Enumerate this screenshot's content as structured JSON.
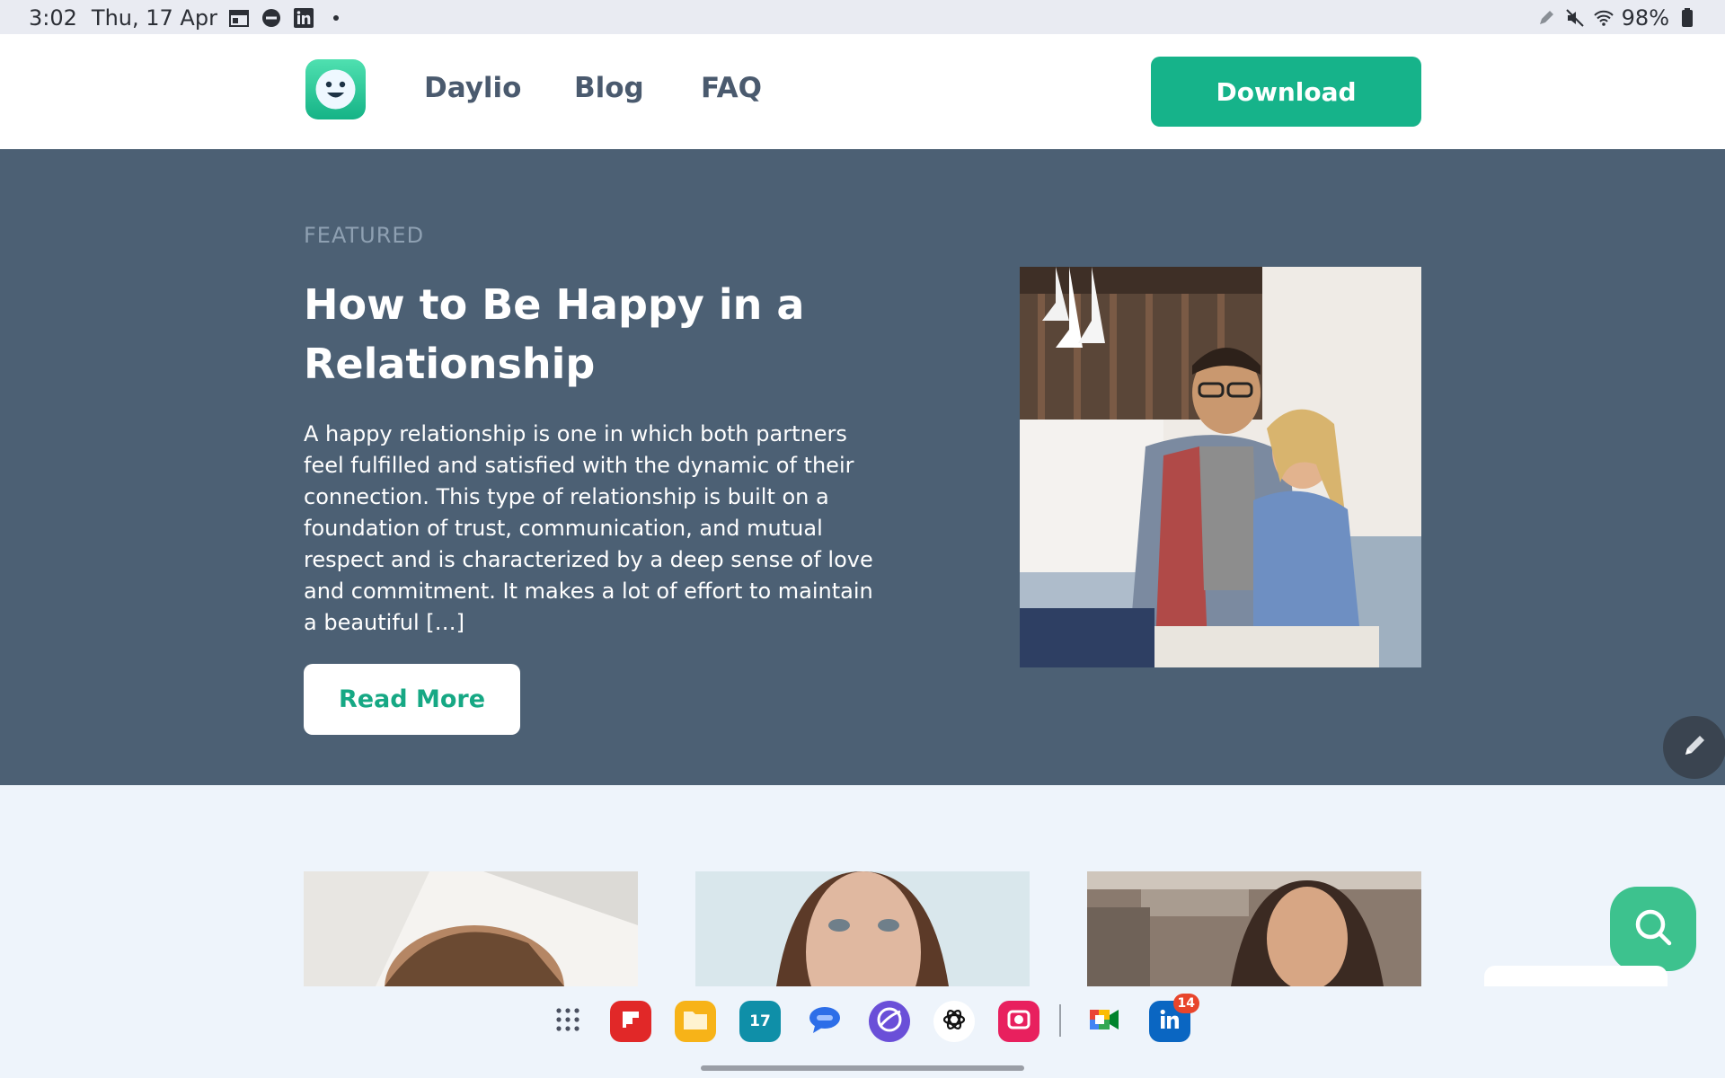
{
  "status_bar": {
    "time": "3:02",
    "date": "Thu, 17 Apr",
    "battery": "98%",
    "left_icons": [
      "calendar-icon",
      "dnd-icon",
      "linkedin-icon",
      "dot-icon"
    ],
    "right_icons": [
      "pen-icon",
      "mute-icon",
      "wifi-icon",
      "battery-icon"
    ]
  },
  "header": {
    "nav": [
      "Daylio",
      "Blog",
      "FAQ"
    ],
    "download_label": "Download",
    "brand_color": "#16b38a"
  },
  "featured": {
    "label": "FEATURED",
    "title": "How to Be Happy in a Relationship",
    "excerpt": "A happy relationship is one in which both partners feel fulfilled and satisfied with the dynamic of their connection. This type of relationship is built on a foundation of trust, communication, and mutual respect and is characterized by a deep sense of love and commitment. It makes a lot of effort to maintain a beautiful […]",
    "read_more_label": "Read More",
    "image_alt": "couple-on-sofa"
  },
  "dock": {
    "items": [
      {
        "name": "app-drawer",
        "icon": "grid-icon"
      },
      {
        "name": "flipboard",
        "icon": "flipboard-icon",
        "color": "#e12828"
      },
      {
        "name": "files",
        "icon": "folder-icon",
        "color": "#f7b318"
      },
      {
        "name": "calendar",
        "icon": "calendar-icon",
        "color": "#0f8fa8",
        "label": "17"
      },
      {
        "name": "messages",
        "icon": "chat-icon",
        "color": "#2d6ee8"
      },
      {
        "name": "internet",
        "icon": "browser-icon",
        "color": "#6a4fd8"
      },
      {
        "name": "chatgpt",
        "icon": "openai-icon",
        "color": "#ffffff"
      },
      {
        "name": "screen-recorder",
        "icon": "camera-icon",
        "color": "#e8205e"
      },
      {
        "name": "meet",
        "icon": "video-icon",
        "color": "#ffffff"
      },
      {
        "name": "linkedin",
        "icon": "linkedin-icon",
        "color": "#0a66c2",
        "badge": "14"
      }
    ]
  }
}
